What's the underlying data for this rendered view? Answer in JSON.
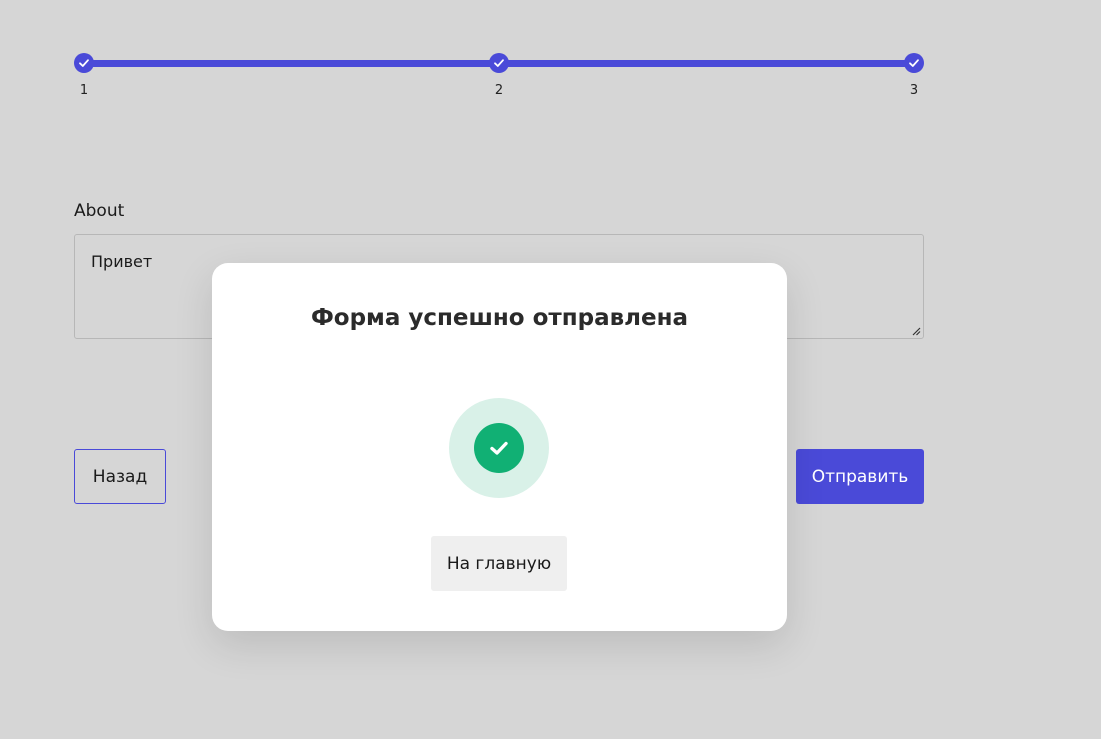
{
  "stepper": {
    "steps": [
      {
        "number": "1",
        "completed": true
      },
      {
        "number": "2",
        "completed": true
      },
      {
        "number": "3",
        "completed": true
      }
    ],
    "progress": 1.0
  },
  "form": {
    "about_label": "About",
    "about_value": "Привет"
  },
  "buttons": {
    "back_label": "Назад",
    "submit_label": "Отправить"
  },
  "modal": {
    "title": "Форма успешно отправлена",
    "success_icon": "check-circle-icon",
    "home_button_label": "На главную"
  },
  "colors": {
    "accent": "#4a4ad8",
    "success": "#11b074",
    "success_bg": "#d9f1e8",
    "page_bg": "#d6d6d6"
  }
}
